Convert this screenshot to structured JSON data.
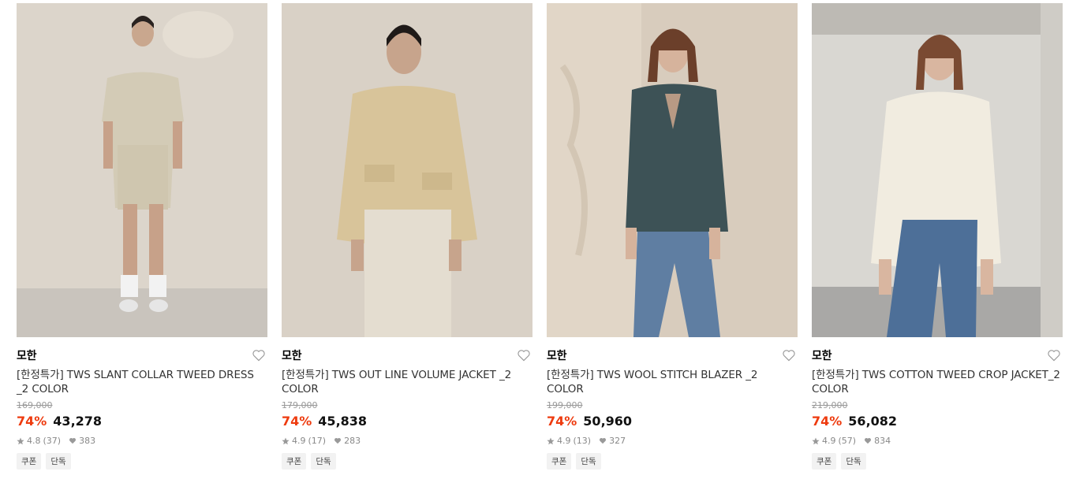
{
  "products": [
    {
      "brand": "모한",
      "title": "[한정특가] TWS SLANT COLLAR TWEED DRESS _2 COLOR",
      "original_price": "169,000",
      "discount": "74%",
      "price": "43,278",
      "rating": "4.8",
      "reviews": "(37)",
      "likes": "383",
      "tags": [
        "쿠폰",
        "단독"
      ]
    },
    {
      "brand": "모한",
      "title": "[한정특가] TWS OUT LINE VOLUME JACKET _2 COLOR",
      "original_price": "179,000",
      "discount": "74%",
      "price": "45,838",
      "rating": "4.9",
      "reviews": "(17)",
      "likes": "283",
      "tags": [
        "쿠폰",
        "단독"
      ]
    },
    {
      "brand": "모한",
      "title": "[한정특가] TWS WOOL STITCH BLAZER _2 COLOR",
      "original_price": "199,000",
      "discount": "74%",
      "price": "50,960",
      "rating": "4.9",
      "reviews": "(13)",
      "likes": "327",
      "tags": [
        "쿠폰",
        "단독"
      ]
    },
    {
      "brand": "모한",
      "title": "[한정특가] TWS COTTON TWEED CROP JACKET_2 COLOR",
      "original_price": "219,000",
      "discount": "74%",
      "price": "56,082",
      "rating": "4.9",
      "reviews": "(57)",
      "likes": "834",
      "tags": [
        "쿠폰",
        "단독"
      ]
    }
  ],
  "colors": {
    "discount": "#ee3b0f",
    "tag_bg": "#f2f2f2",
    "muted": "#888888"
  },
  "icons": {
    "heart": "heart-outline-icon",
    "star": "star-icon",
    "like": "heart-filled-icon"
  }
}
